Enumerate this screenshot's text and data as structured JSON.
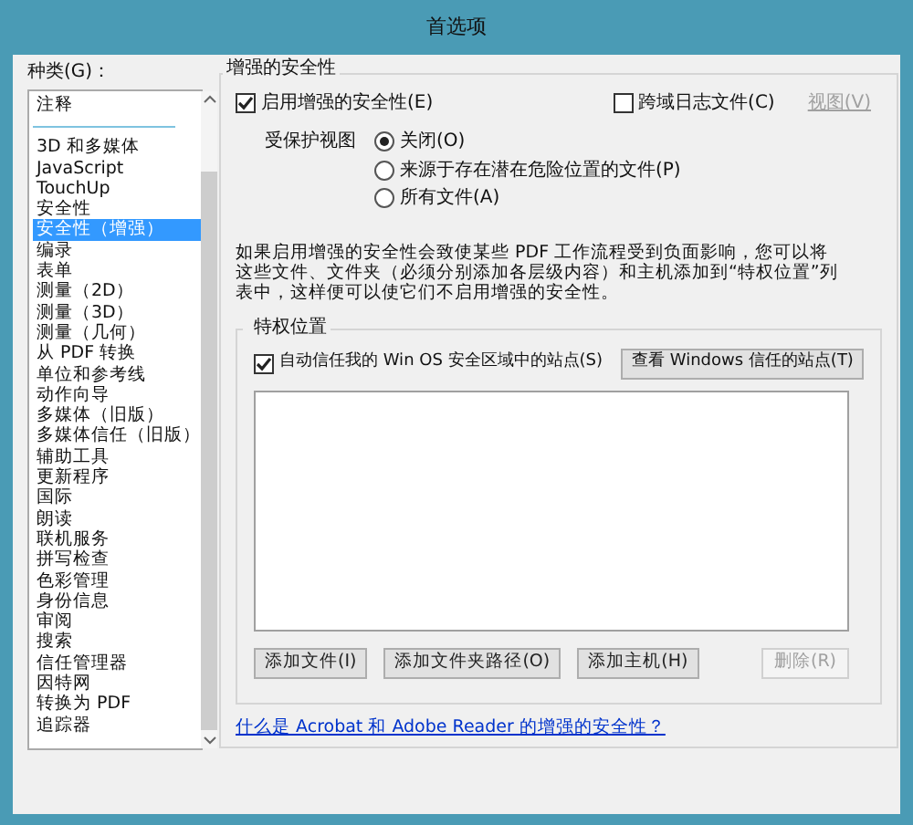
{
  "window": {
    "title": "首选项"
  },
  "categories": {
    "label": "种类(G)：",
    "items": [
      {
        "label": "注释",
        "selected": false
      },
      {
        "label": "3D 和多媒体",
        "selected": false
      },
      {
        "label": "JavaScript",
        "selected": false
      },
      {
        "label": "TouchUp",
        "selected": false
      },
      {
        "label": "安全性",
        "selected": false
      },
      {
        "label": "安全性（增强）",
        "selected": true
      },
      {
        "label": "编录",
        "selected": false
      },
      {
        "label": "表单",
        "selected": false
      },
      {
        "label": "测量（2D）",
        "selected": false
      },
      {
        "label": "测量（3D）",
        "selected": false
      },
      {
        "label": "测量（几何）",
        "selected": false
      },
      {
        "label": "从 PDF 转换",
        "selected": false
      },
      {
        "label": "单位和参考线",
        "selected": false
      },
      {
        "label": "动作向导",
        "selected": false
      },
      {
        "label": "多媒体（旧版）",
        "selected": false
      },
      {
        "label": "多媒体信任（旧版）",
        "selected": false
      },
      {
        "label": "辅助工具",
        "selected": false
      },
      {
        "label": "更新程序",
        "selected": false
      },
      {
        "label": "国际",
        "selected": false
      },
      {
        "label": "朗读",
        "selected": false
      },
      {
        "label": "联机服务",
        "selected": false
      },
      {
        "label": "拼写检查",
        "selected": false
      },
      {
        "label": "色彩管理",
        "selected": false
      },
      {
        "label": "身份信息",
        "selected": false
      },
      {
        "label": "审阅",
        "selected": false
      },
      {
        "label": "搜索",
        "selected": false
      },
      {
        "label": "信任管理器",
        "selected": false
      },
      {
        "label": "因特网",
        "selected": false
      },
      {
        "label": "转换为 PDF",
        "selected": false
      },
      {
        "label": "追踪器",
        "selected": false
      }
    ]
  },
  "security": {
    "title": "增强的安全性",
    "enable": {
      "label": "启用增强的安全性(E)",
      "checked": true
    },
    "cross_domain": {
      "label": "跨域日志文件(C)",
      "checked": false
    },
    "view_link": {
      "label": "视图(V)",
      "disabled": true
    },
    "protected_view": {
      "label": "受保护视图",
      "options": [
        {
          "label": "关闭(O)",
          "selected": true
        },
        {
          "label": "来源于存在潜在危险位置的文件(P)",
          "selected": false
        },
        {
          "label": "所有文件(A)",
          "selected": false
        }
      ]
    },
    "description": "如果启用增强的安全性会致使某些 PDF 工作流程受到负面影响，您可以将这些文件、文件夹（必须分别添加各层级内容）和主机添加到“特权位置”列表中，这样便可以使它们不启用增强的安全性。",
    "privileged": {
      "title": "特权位置",
      "auto_trust": {
        "label": "自动信任我的 Win OS 安全区域中的站点(S)",
        "checked": true
      },
      "view_button": "查看 Windows 信任的站点(T)",
      "buttons": [
        {
          "label": "添加文件(I)",
          "disabled": false
        },
        {
          "label": "添加文件夹路径(O)",
          "disabled": false
        },
        {
          "label": "添加主机(H)",
          "disabled": false
        },
        {
          "label": "删除(R)",
          "disabled": true
        }
      ]
    },
    "help_link": "什么是 Acrobat 和 Adobe Reader 的增强的安全性？"
  }
}
